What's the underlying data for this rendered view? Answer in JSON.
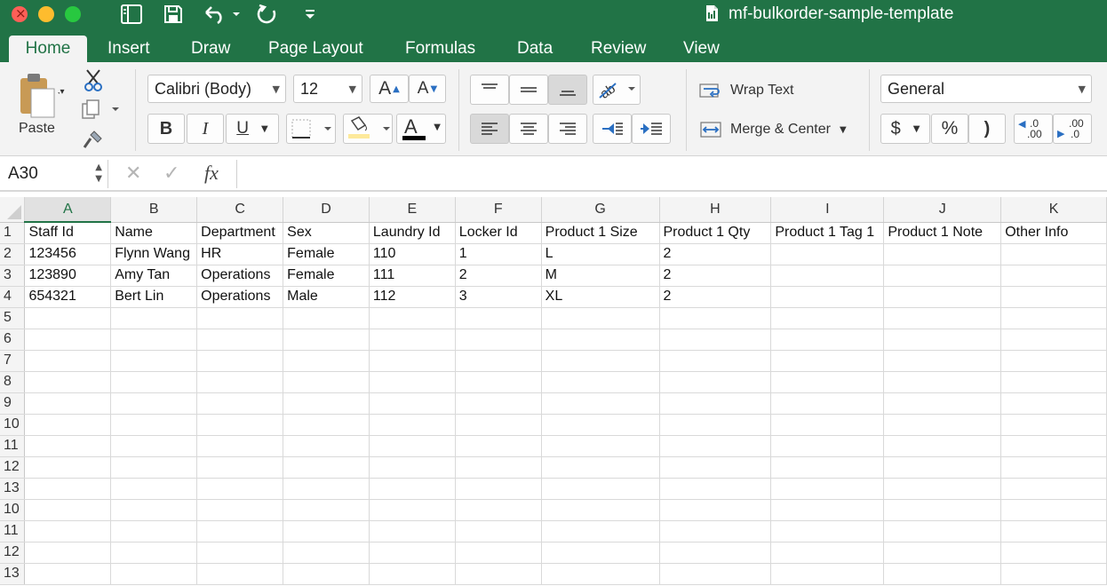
{
  "window": {
    "title": "mf-bulkorder-sample-template"
  },
  "tabs": [
    {
      "label": "Home"
    },
    {
      "label": "Insert"
    },
    {
      "label": "Draw"
    },
    {
      "label": "Page Layout"
    },
    {
      "label": "Formulas"
    },
    {
      "label": "Data"
    },
    {
      "label": "Review"
    },
    {
      "label": "View"
    }
  ],
  "ribbon": {
    "paste_label": "Paste",
    "font_name": "Calibri (Body)",
    "font_size": "12",
    "bold_label": "B",
    "italic_label": "I",
    "underline_label": "U",
    "font_color_label": "A",
    "grow_font_label": "A",
    "shrink_font_label": "A",
    "wrap_text_label": "Wrap Text",
    "merge_center_label": "Merge & Center",
    "number_format": "General",
    "currency_label": "$",
    "percent_label": "%",
    "comma_label": ")",
    "increase_decimal_top": ".0",
    "increase_decimal_bottom": ".00",
    "decrease_decimal_top": ".00",
    "decrease_decimal_bottom": ".0",
    "colors": {
      "brand": "#217346",
      "font_color_bar": "#000000",
      "fill_color_bar": "#fde99b"
    }
  },
  "formula_bar": {
    "cell_ref": "A30",
    "fx_label": "fx",
    "content": ""
  },
  "sheet": {
    "selected_column": "A",
    "columns": [
      "A",
      "B",
      "C",
      "D",
      "E",
      "F",
      "G",
      "H",
      "I",
      "J",
      "K"
    ],
    "row_numbers": [
      "1",
      "2",
      "3",
      "4",
      "5",
      "6",
      "7",
      "8",
      "9",
      "10",
      "11",
      "12",
      "13",
      "10",
      "11",
      "12",
      "13"
    ],
    "rows": [
      [
        "Staff Id",
        "Name",
        "Department",
        "Sex",
        "Laundry Id",
        "Locker Id",
        "Product 1 Size",
        "Product 1 Qty",
        "Product 1 Tag 1",
        "Product 1 Note",
        "Other Info"
      ],
      [
        "123456",
        "Flynn Wang",
        "HR",
        "Female",
        "110",
        "1",
        "L",
        "2",
        "",
        "",
        ""
      ],
      [
        "123890",
        "Amy Tan",
        "Operations",
        "Female",
        "111",
        "2",
        "M",
        "2",
        "",
        "",
        ""
      ],
      [
        "654321",
        "Bert Lin",
        "Operations",
        "Male",
        "112",
        "3",
        "XL",
        "2",
        "",
        "",
        ""
      ],
      [
        "",
        "",
        "",
        "",
        "",
        "",
        "",
        "",
        "",
        "",
        ""
      ],
      [
        "",
        "",
        "",
        "",
        "",
        "",
        "",
        "",
        "",
        "",
        ""
      ],
      [
        "",
        "",
        "",
        "",
        "",
        "",
        "",
        "",
        "",
        "",
        ""
      ],
      [
        "",
        "",
        "",
        "",
        "",
        "",
        "",
        "",
        "",
        "",
        ""
      ],
      [
        "",
        "",
        "",
        "",
        "",
        "",
        "",
        "",
        "",
        "",
        ""
      ],
      [
        "",
        "",
        "",
        "",
        "",
        "",
        "",
        "",
        "",
        "",
        ""
      ],
      [
        "",
        "",
        "",
        "",
        "",
        "",
        "",
        "",
        "",
        "",
        ""
      ],
      [
        "",
        "",
        "",
        "",
        "",
        "",
        "",
        "",
        "",
        "",
        ""
      ],
      [
        "",
        "",
        "",
        "",
        "",
        "",
        "",
        "",
        "",
        "",
        ""
      ],
      [
        "",
        "",
        "",
        "",
        "",
        "",
        "",
        "",
        "",
        "",
        ""
      ],
      [
        "",
        "",
        "",
        "",
        "",
        "",
        "",
        "",
        "",
        "",
        ""
      ],
      [
        "",
        "",
        "",
        "",
        "",
        "",
        "",
        "",
        "",
        "",
        ""
      ],
      [
        "",
        "",
        "",
        "",
        "",
        "",
        "",
        "",
        "",
        "",
        ""
      ]
    ]
  }
}
